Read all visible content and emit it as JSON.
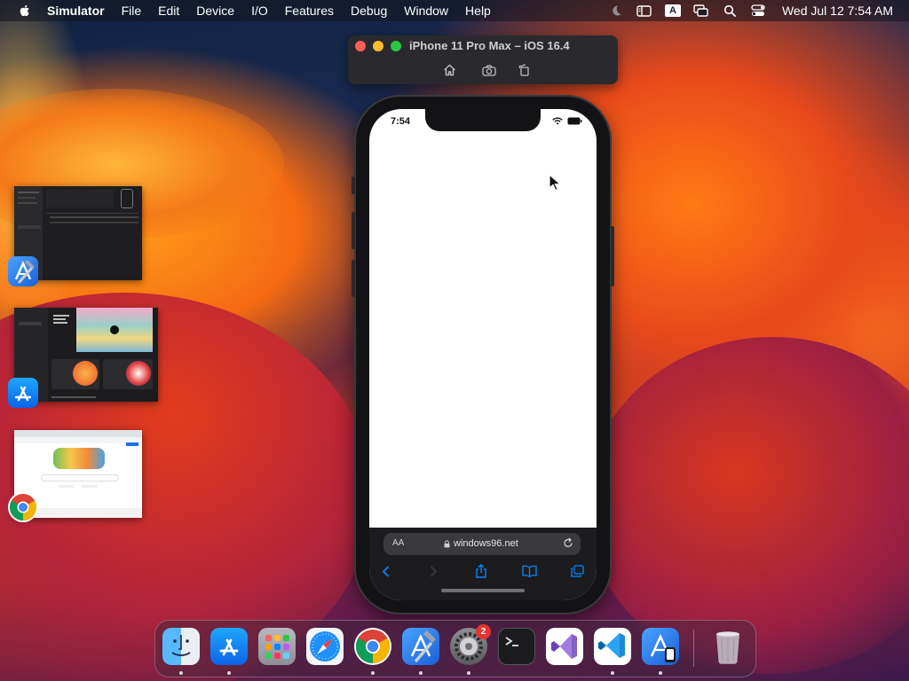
{
  "menubar": {
    "app_name": "Simulator",
    "items": [
      "File",
      "Edit",
      "Device",
      "I/O",
      "Features",
      "Debug",
      "Window",
      "Help"
    ],
    "input_source": "A",
    "clock": "Wed Jul 12  7:54 AM"
  },
  "simulator_window": {
    "title": "iPhone 11 Pro Max – iOS 16.4"
  },
  "phone": {
    "status_time": "7:54",
    "url_text_size_label": "AA",
    "url": "windows96.net"
  },
  "dock": {
    "system_settings_badge": "2"
  },
  "colors": {
    "accent_blue": "#0a84ff",
    "badge_red": "#e5352f"
  }
}
